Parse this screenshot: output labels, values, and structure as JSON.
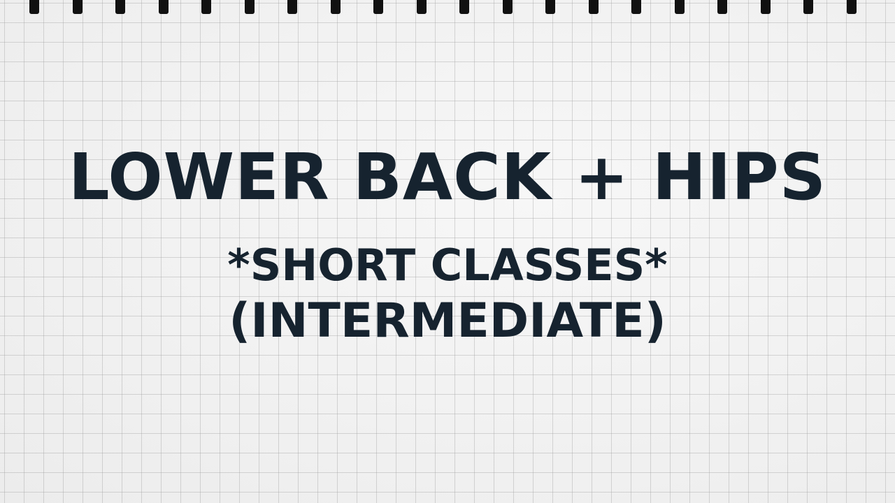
{
  "title": {
    "line1": "LOWER BACK + HIPS",
    "line2": "*SHORT CLASSES*",
    "line3": "(INTERMEDIATE)"
  },
  "colors": {
    "text": "#16232f",
    "paper": "#f3f3f3",
    "grid": "#969696",
    "binding": "#111111"
  }
}
